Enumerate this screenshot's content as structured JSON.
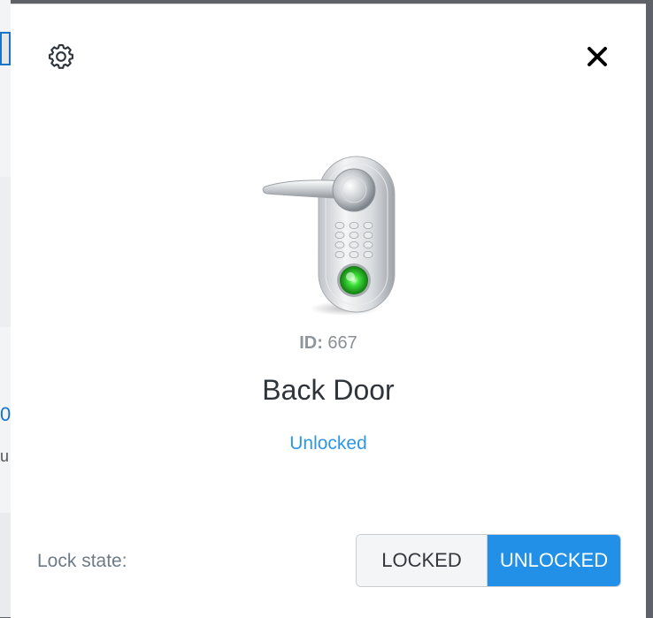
{
  "background": {
    "fragments": [
      "0",
      "u"
    ]
  },
  "modal": {
    "settings_icon": "gear-icon",
    "close_icon": "close-icon",
    "device": {
      "image": "smart-door-lock",
      "id_label": "ID:",
      "id_value": "667",
      "name": "Back Door",
      "status": "Unlocked"
    },
    "lock_state": {
      "label": "Lock state:",
      "options": [
        "LOCKED",
        "UNLOCKED"
      ],
      "selected": "UNLOCKED"
    }
  },
  "colors": {
    "accent": "#2190e6",
    "status_text": "#2f96e6",
    "indicator_green": "#3ee23a"
  }
}
